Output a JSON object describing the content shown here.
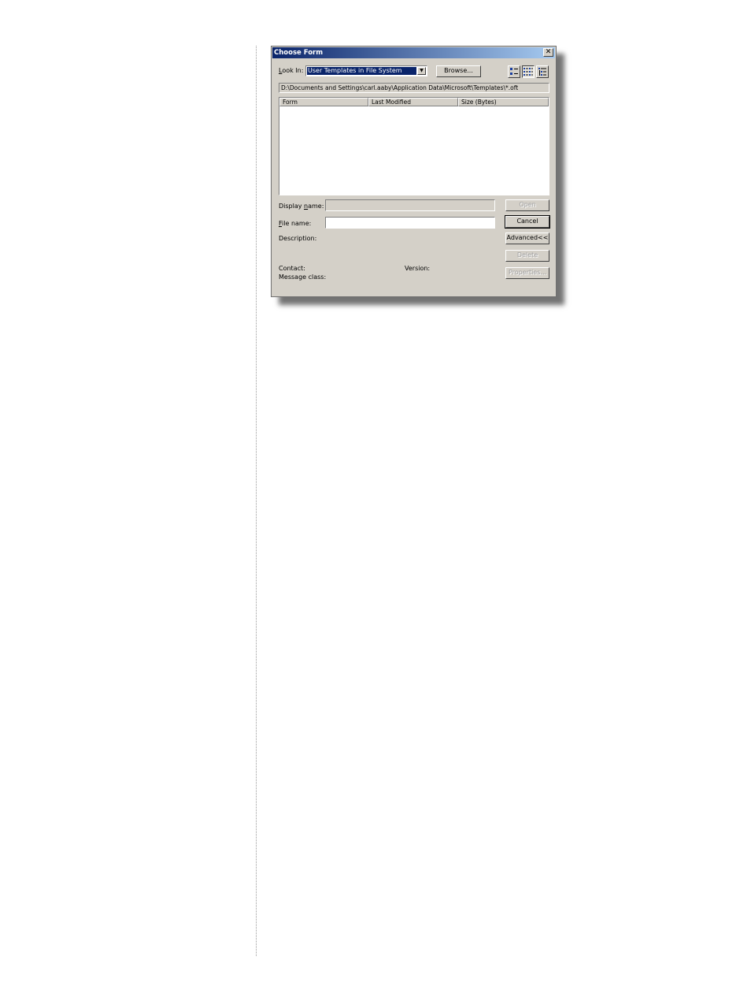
{
  "dialog": {
    "title": "Choose Form",
    "look_in_label_pre": "",
    "look_in_label_u": "L",
    "look_in_label_post": "ook In:",
    "look_in_value": "User Templates in File System",
    "browse_label": "Browse...",
    "path": "D:\\Documents and Settings\\carl.aaby\\Application Data\\Microsoft\\Templates\\*.oft",
    "columns": [
      "Form",
      "Last Modified",
      "Size (Bytes)"
    ],
    "display_name_label_pre": "Display ",
    "display_name_label_u": "n",
    "display_name_label_post": "ame:",
    "display_name_value": "",
    "file_name_label_pre": "",
    "file_name_label_u": "F",
    "file_name_label_post": "ile name:",
    "file_name_value": "",
    "description_label": "Description:",
    "contact_label": "Contact:",
    "version_label": "Version:",
    "message_class_label": "Message class:",
    "buttons": {
      "open": "Open",
      "cancel": "Cancel",
      "advanced": "Advanced<<",
      "delete": "Delete",
      "properties": "Properties..."
    },
    "view_icons": [
      "large-icons-view-icon",
      "list-view-icon",
      "details-view-icon"
    ]
  }
}
